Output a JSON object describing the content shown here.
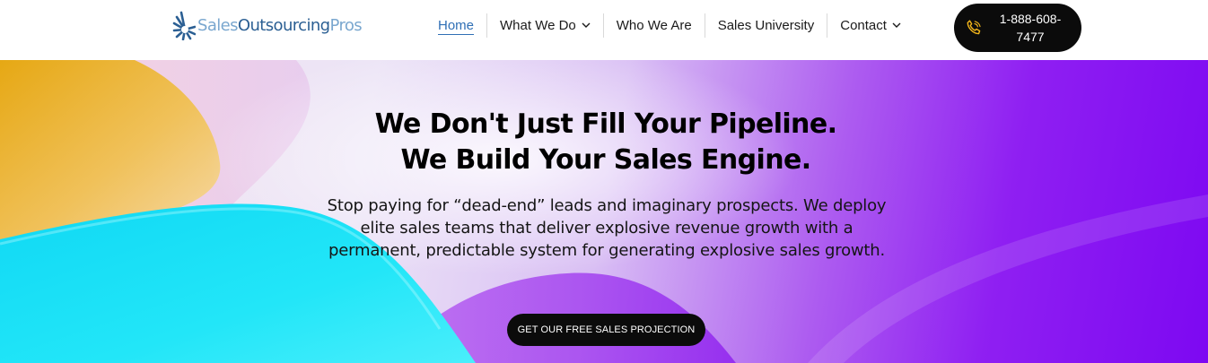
{
  "header": {
    "logo": {
      "text_light_1": "Sales",
      "text_dark": "Outsourcing",
      "text_light_2": "Pros",
      "icon": "burst-logo-icon"
    },
    "nav": [
      {
        "label": "Home",
        "active": true,
        "has_dropdown": false
      },
      {
        "label": "What We Do",
        "active": false,
        "has_dropdown": true
      },
      {
        "label": "Who We Are",
        "active": false,
        "has_dropdown": false
      },
      {
        "label": "Sales University",
        "active": false,
        "has_dropdown": false
      },
      {
        "label": "Contact",
        "active": false,
        "has_dropdown": true
      }
    ],
    "phone": {
      "line1": "1-888-608-",
      "line2": "7477",
      "icon": "phone-icon"
    }
  },
  "hero": {
    "title_line1": "We Don't Just Fill Your Pipeline.",
    "title_line2": "We Build Your Sales Engine.",
    "subtitle": "Stop paying for “dead-end” leads and imaginary prospects. We deploy elite sales teams that deliver explosive revenue growth with a permanent, predictable system for generating explosive sales growth.",
    "cta_label": "GET OUR FREE SALES PROJECTION"
  },
  "colors": {
    "accent_link": "#2f6fb5",
    "logo_dark": "#2b5f93",
    "logo_light": "#7aa7cf",
    "button_bg": "#0b0b0b",
    "phone_icon": "#f2b51a",
    "hero_cyan": "#16e4f7",
    "hero_gold": "#e6a814",
    "hero_purple": "#7d08f2"
  }
}
